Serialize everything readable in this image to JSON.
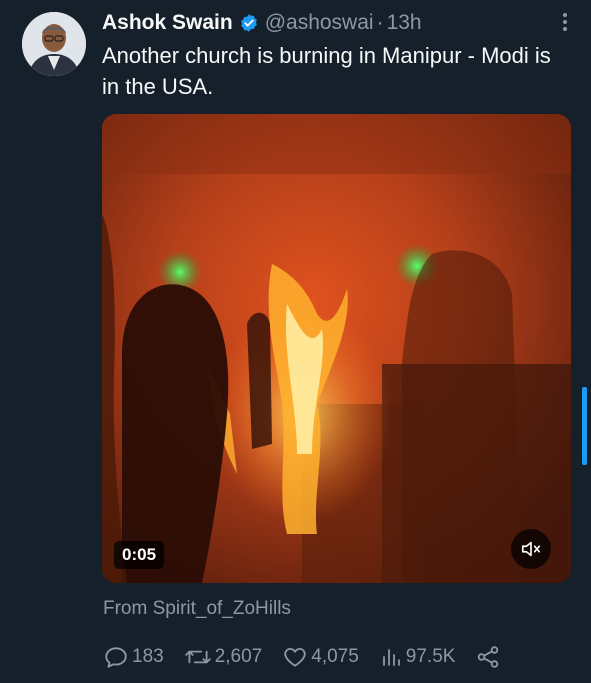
{
  "author": {
    "name": "Ashok Swain",
    "handle": "@ashoswai",
    "separator": "·",
    "time": "13h"
  },
  "tweet": {
    "text": "Another church is burning in Manipur - Modi is in the USA."
  },
  "video": {
    "duration": "0:05",
    "muted": true
  },
  "attribution": "From Spirit_of_ZoHills",
  "actions": {
    "replies": "183",
    "retweets": "2,607",
    "likes": "4,075",
    "views": "97.5K"
  },
  "icons": [
    "verified-icon",
    "more-icon",
    "mute-icon",
    "reply-icon",
    "retweet-icon",
    "like-icon",
    "views-icon",
    "share-icon"
  ],
  "colors": {
    "background": "#15202b",
    "text": "#f7f9f9",
    "secondary": "#8b98a5",
    "accent": "#1d9bf0"
  }
}
